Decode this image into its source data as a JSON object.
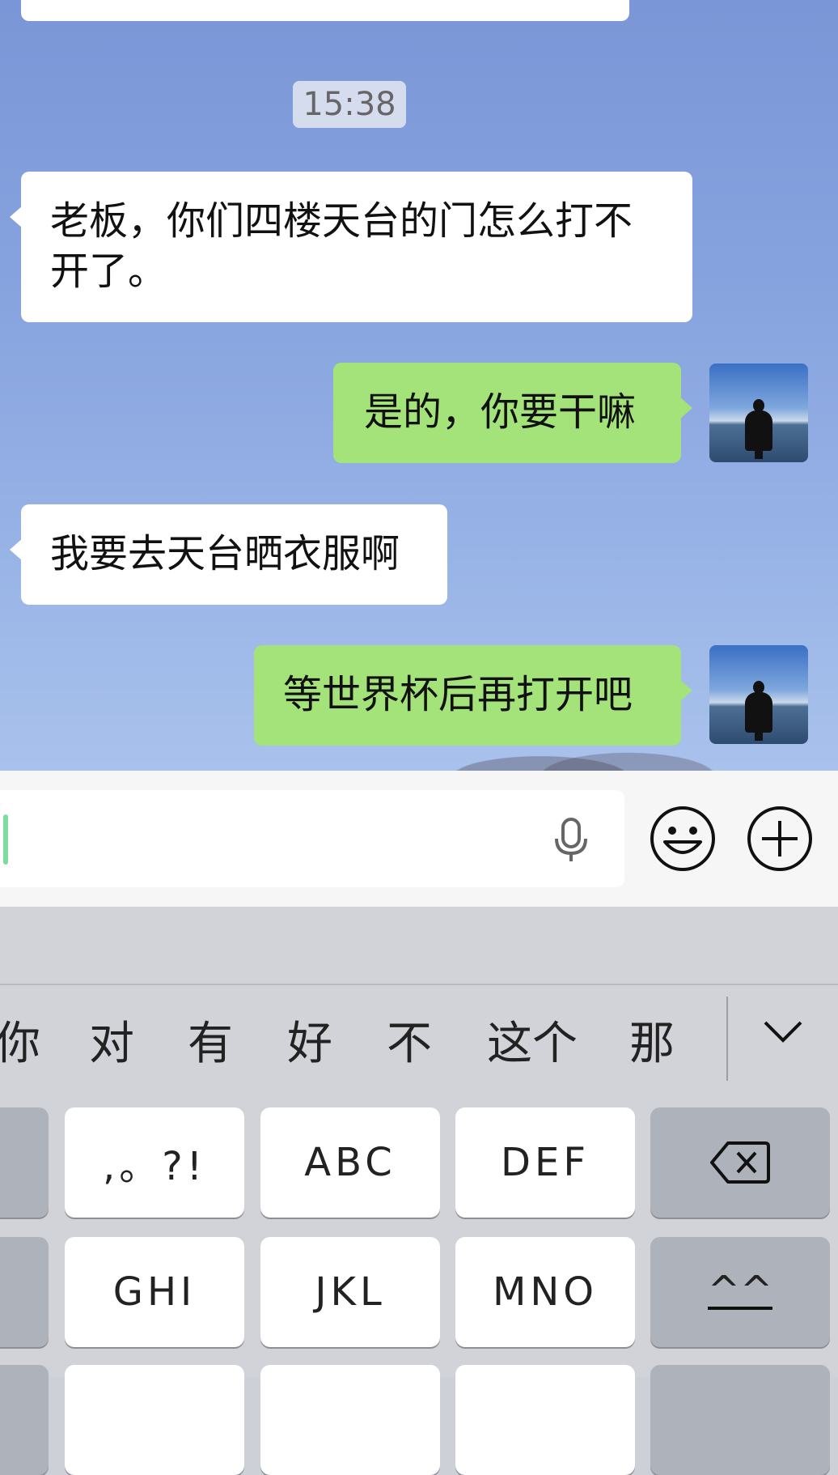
{
  "chat": {
    "timestamp": "15:38",
    "messages": [
      {
        "side": "left",
        "text": "老板，你们四楼天台的门怎么打不开了。"
      },
      {
        "side": "right",
        "text": "是的，你要干嘛"
      },
      {
        "side": "left",
        "text": "我要去天台晒衣服啊"
      },
      {
        "side": "right",
        "text": "等世界杯后再打开吧"
      }
    ]
  },
  "input_bar": {
    "icons": [
      "microphone-icon",
      "emoji-icon",
      "plus-icon"
    ]
  },
  "keyboard": {
    "candidates": [
      "你",
      "对",
      "有",
      "好",
      "不",
      "这个",
      "那"
    ],
    "collapse_icon": "chevron-down-icon",
    "row1": [
      ",。?!",
      "ABC",
      "DEF"
    ],
    "row2": [
      "GHI",
      "JKL",
      "MNO"
    ],
    "backspace_icon": "backspace-icon",
    "emoticon_key": "^^"
  },
  "colors": {
    "outgoing_bubble": "#a4e27a",
    "incoming_bubble": "#ffffff",
    "cursor": "#7fdca0"
  }
}
